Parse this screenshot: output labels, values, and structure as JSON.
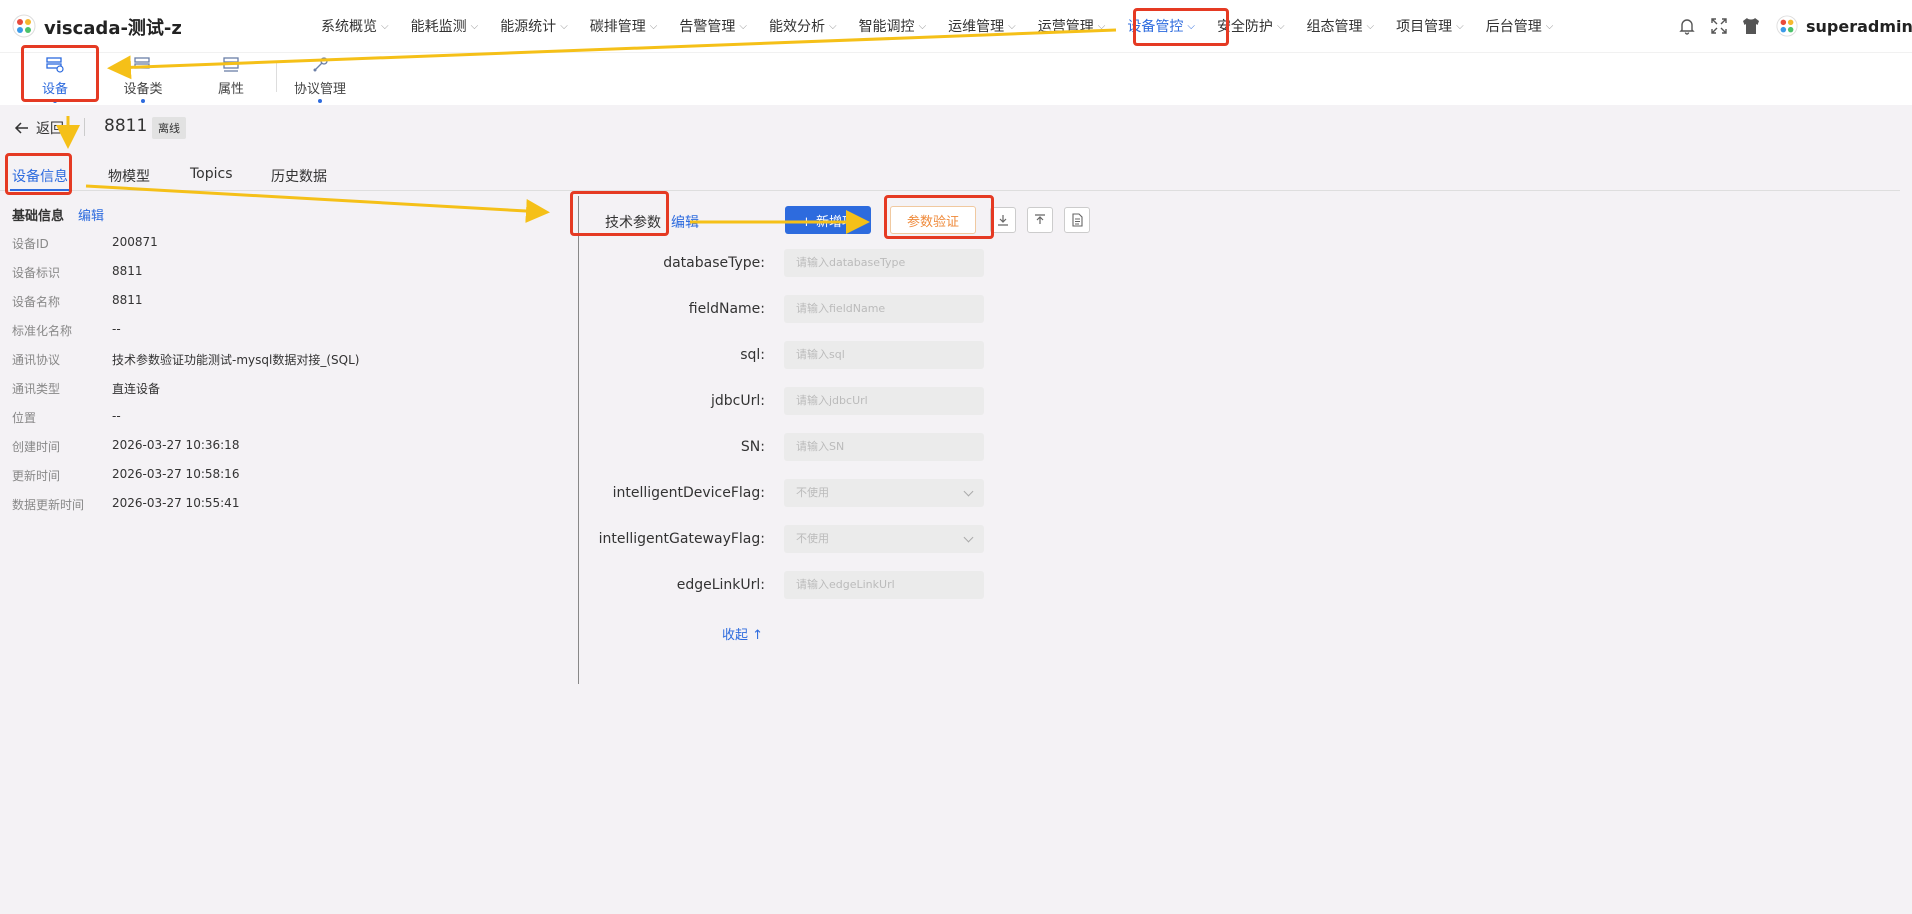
{
  "app": {
    "title": "viscada-测试-z"
  },
  "nav": {
    "items": [
      {
        "label": "系统概览",
        "active": false
      },
      {
        "label": "能耗监测",
        "active": false
      },
      {
        "label": "能源统计",
        "active": false
      },
      {
        "label": "碳排管理",
        "active": false
      },
      {
        "label": "告警管理",
        "active": false
      },
      {
        "label": "能效分析",
        "active": false
      },
      {
        "label": "智能调控",
        "active": false
      },
      {
        "label": "运维管理",
        "active": false
      },
      {
        "label": "运营管理",
        "active": false
      },
      {
        "label": "设备管控",
        "active": true
      },
      {
        "label": "安全防护",
        "active": false
      },
      {
        "label": "组态管理",
        "active": false
      },
      {
        "label": "项目管理",
        "active": false
      },
      {
        "label": "后台管理",
        "active": false
      }
    ],
    "right_icons": [
      "bell-icon",
      "fullscreen-icon",
      "theme-shirt-icon"
    ],
    "user": "superadmin"
  },
  "subtabs": [
    {
      "label": "设备",
      "icon": "device-icon",
      "active": true
    },
    {
      "label": "设备类",
      "icon": "device-class-icon",
      "active": false
    },
    {
      "label": "属性",
      "icon": "attribute-icon",
      "active": false
    },
    {
      "label": "协议管理",
      "icon": "protocol-icon",
      "active": false
    }
  ],
  "header": {
    "back_label": "返回",
    "device_code": "8811",
    "status": "离线"
  },
  "tabs": [
    "设备信息",
    "物模型",
    "Topics",
    "历史数据"
  ],
  "basic_info": {
    "title": "基础信息",
    "edit_label": "编辑",
    "rows": [
      {
        "key": "设备ID",
        "value": "200871"
      },
      {
        "key": "设备标识",
        "value": "8811"
      },
      {
        "key": "设备名称",
        "value": "8811"
      },
      {
        "key": "标准化名称",
        "value": "--"
      },
      {
        "key": "通讯协议",
        "value": "技术参数验证功能测试-mysql数据对接_(SQL)"
      },
      {
        "key": "通讯类型",
        "value": "直连设备"
      },
      {
        "key": "位置",
        "value": "--"
      },
      {
        "key": "创建时间",
        "value": "2026-03-27 10:36:18"
      },
      {
        "key": "更新时间",
        "value": "2026-03-27 10:58:16"
      },
      {
        "key": "数据更新时间",
        "value": "2026-03-27 10:55:41"
      }
    ]
  },
  "tech_params": {
    "title": "技术参数",
    "edit_label": "编辑",
    "add_label": "+ 新增项",
    "verify_label": "参数验证",
    "fields": [
      {
        "label": "databaseType:",
        "placeholder": "请输入databaseType",
        "type": "input"
      },
      {
        "label": "fieldName:",
        "placeholder": "请输入fieldName",
        "type": "input"
      },
      {
        "label": "sql:",
        "placeholder": "请输入sql",
        "type": "input"
      },
      {
        "label": "jdbcUrl:",
        "placeholder": "请输入jdbcUrl",
        "type": "input"
      },
      {
        "label": "SN:",
        "placeholder": "请输入SN",
        "type": "input"
      },
      {
        "label": "intelligentDeviceFlag:",
        "placeholder": "不使用",
        "type": "select"
      },
      {
        "label": "intelligentGatewayFlag:",
        "placeholder": "不使用",
        "type": "select"
      },
      {
        "label": "edgeLinkUrl:",
        "placeholder": "请输入edgeLinkUrl",
        "type": "input"
      }
    ],
    "collapse_label": "收起 ↑"
  },
  "colors": {
    "accent": "#2d6bde",
    "annotation_red": "#e53a23",
    "annotation_arrow": "#f5c018",
    "verify_orange": "#ef8a3b"
  }
}
